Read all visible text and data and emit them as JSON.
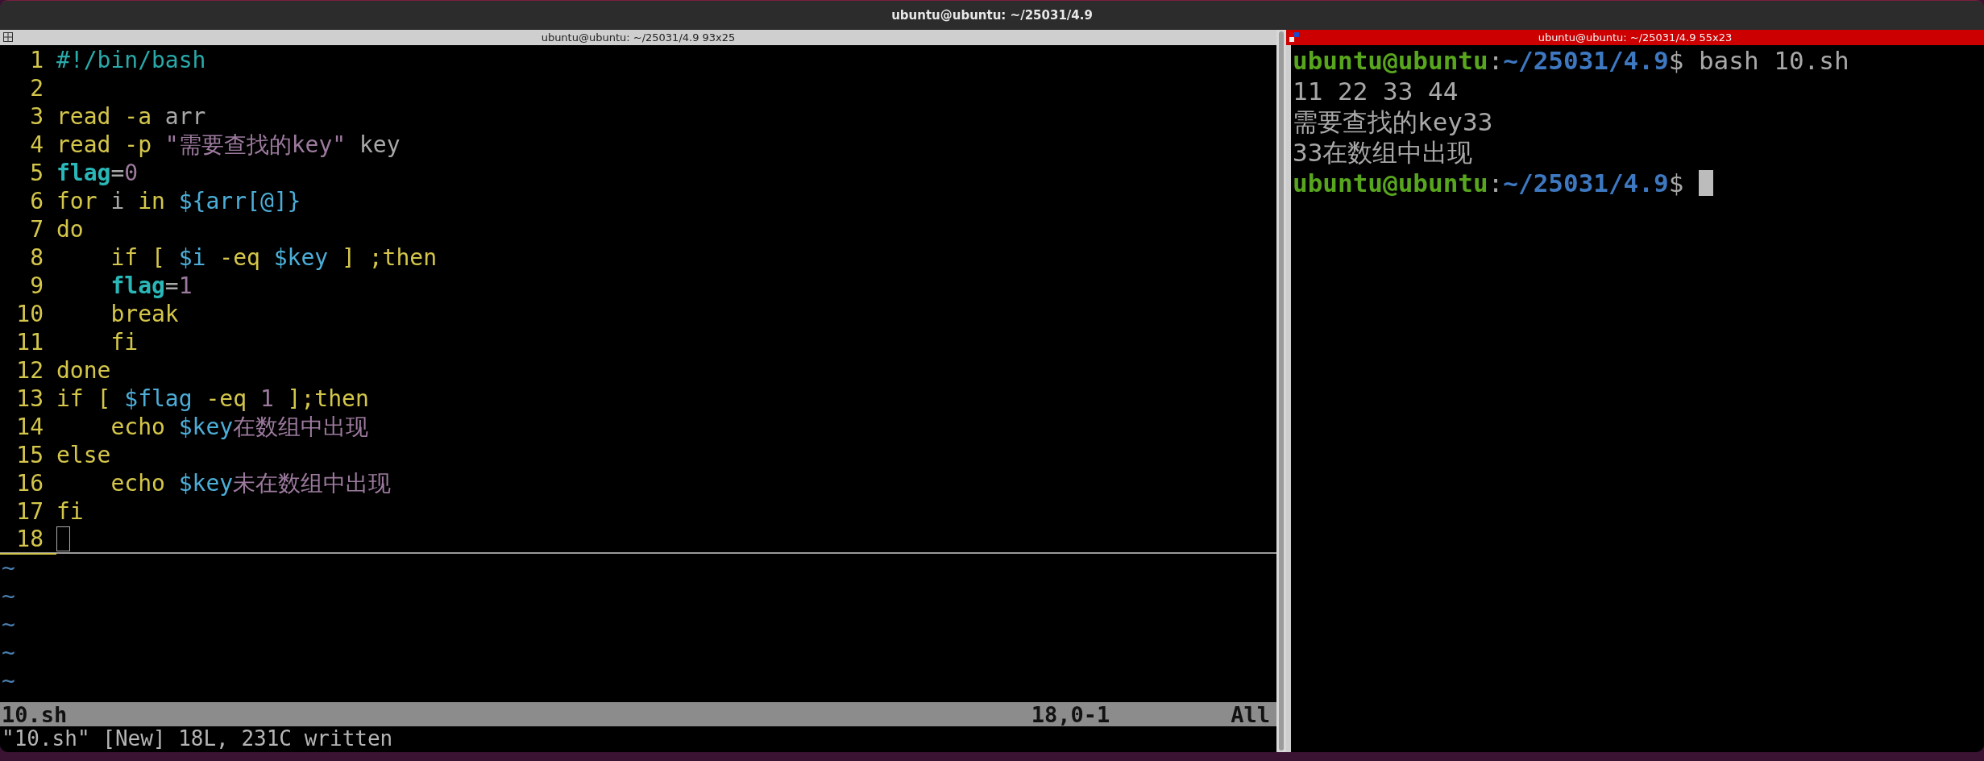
{
  "window": {
    "title": "ubuntu@ubuntu: ~/25031/4.9"
  },
  "editor_pane": {
    "title": "ubuntu@ubuntu: ~/25031/4.9 93x25",
    "lines": [
      {
        "number": "1",
        "cursor": false,
        "tokens": [
          {
            "text": "#!/bin/bash",
            "kind": "comment"
          }
        ]
      },
      {
        "number": "2",
        "cursor": false
      },
      {
        "number": "3",
        "cursor": false,
        "tokens": [
          {
            "text": "read -a ",
            "kind": "keyword"
          },
          {
            "text": "arr",
            "kind": "plain"
          }
        ]
      },
      {
        "number": "4",
        "cursor": false,
        "tokens": [
          {
            "text": "read -p ",
            "kind": "keyword"
          },
          {
            "text": "\"需要查找的key\"",
            "kind": "string"
          },
          {
            "text": " key",
            "kind": "plain"
          }
        ]
      },
      {
        "number": "5",
        "cursor": false,
        "tokens": [
          {
            "text": "flag",
            "kind": "identifier"
          },
          {
            "text": "=",
            "kind": "plain"
          },
          {
            "text": "0",
            "kind": "string"
          }
        ]
      },
      {
        "number": "6",
        "cursor": false,
        "tokens": [
          {
            "text": "for ",
            "kind": "keyword"
          },
          {
            "text": "i ",
            "kind": "plain"
          },
          {
            "text": "in ",
            "kind": "keyword"
          },
          {
            "text": "${arr[@]}",
            "kind": "variable"
          }
        ]
      },
      {
        "number": "7",
        "cursor": false,
        "tokens": [
          {
            "text": "do",
            "kind": "keyword"
          }
        ]
      },
      {
        "number": "8",
        "cursor": false,
        "tokens": [
          {
            "text": "    if [ ",
            "kind": "keyword"
          },
          {
            "text": "$i",
            "kind": "variable"
          },
          {
            "text": " -eq ",
            "kind": "keyword"
          },
          {
            "text": "$key",
            "kind": "variable"
          },
          {
            "text": " ] ;then",
            "kind": "keyword"
          }
        ]
      },
      {
        "number": "9",
        "cursor": false,
        "tokens": [
          {
            "text": "    flag",
            "kind": "identifier"
          },
          {
            "text": "=",
            "kind": "plain"
          },
          {
            "text": "1",
            "kind": "string"
          }
        ]
      },
      {
        "number": "10",
        "cursor": false,
        "tokens": [
          {
            "text": "    break",
            "kind": "keyword"
          }
        ]
      },
      {
        "number": "11",
        "cursor": false,
        "tokens": [
          {
            "text": "    fi",
            "kind": "keyword"
          }
        ]
      },
      {
        "number": "12",
        "cursor": false,
        "tokens": [
          {
            "text": "done",
            "kind": "keyword"
          }
        ]
      },
      {
        "number": "13",
        "cursor": false,
        "tokens": [
          {
            "text": "if [ ",
            "kind": "keyword"
          },
          {
            "text": "$flag",
            "kind": "variable"
          },
          {
            "text": " -eq ",
            "kind": "keyword"
          },
          {
            "text": "1",
            "kind": "string"
          },
          {
            "text": " ];then",
            "kind": "keyword"
          }
        ]
      },
      {
        "number": "14",
        "cursor": false,
        "tokens": [
          {
            "text": "    echo ",
            "kind": "keyword"
          },
          {
            "text": "$key",
            "kind": "variable"
          },
          {
            "text": "在数组中出现",
            "kind": "string"
          }
        ]
      },
      {
        "number": "15",
        "cursor": false,
        "tokens": [
          {
            "text": "else",
            "kind": "keyword"
          }
        ]
      },
      {
        "number": "16",
        "cursor": false,
        "tokens": [
          {
            "text": "    echo ",
            "kind": "keyword"
          },
          {
            "text": "$key",
            "kind": "variable"
          },
          {
            "text": "未在数组中出现",
            "kind": "string"
          }
        ]
      },
      {
        "number": "17",
        "cursor": false,
        "tokens": [
          {
            "text": "fi",
            "kind": "keyword"
          }
        ]
      },
      {
        "number": "18",
        "cursor": true
      }
    ],
    "empty_lines": [
      "~",
      "~",
      "~",
      "~",
      "~"
    ],
    "status_bar": {
      "file": "10.sh",
      "position": "18,0-1",
      "scroll": "All"
    },
    "message": "\"10.sh\" [New] 18L, 231C written"
  },
  "terminal_pane": {
    "title": "ubuntu@ubuntu: ~/25031/4.9 55x23",
    "lines": [
      {
        "tokens": [
          {
            "text": "ubuntu@ubuntu",
            "kind": "user"
          },
          {
            "text": ":",
            "kind": "plain"
          },
          {
            "text": "~/25031/4.9",
            "kind": "path"
          },
          {
            "text": "$ bash 10.sh",
            "kind": "plain"
          }
        ],
        "cursor": false
      },
      {
        "tokens": [
          {
            "text": "11 22 33 44",
            "kind": "plain"
          }
        ],
        "cursor": false
      },
      {
        "tokens": [
          {
            "text": "需要查找的key33",
            "kind": "plain"
          }
        ],
        "cursor": false
      },
      {
        "tokens": [
          {
            "text": "33在数组中出现",
            "kind": "plain"
          }
        ],
        "cursor": false
      },
      {
        "tokens": [
          {
            "text": "ubuntu@ubuntu",
            "kind": "user"
          },
          {
            "text": ":",
            "kind": "plain"
          },
          {
            "text": "~/25031/4.9",
            "kind": "path"
          },
          {
            "text": "$ ",
            "kind": "plain"
          }
        ],
        "cursor": true
      }
    ]
  }
}
